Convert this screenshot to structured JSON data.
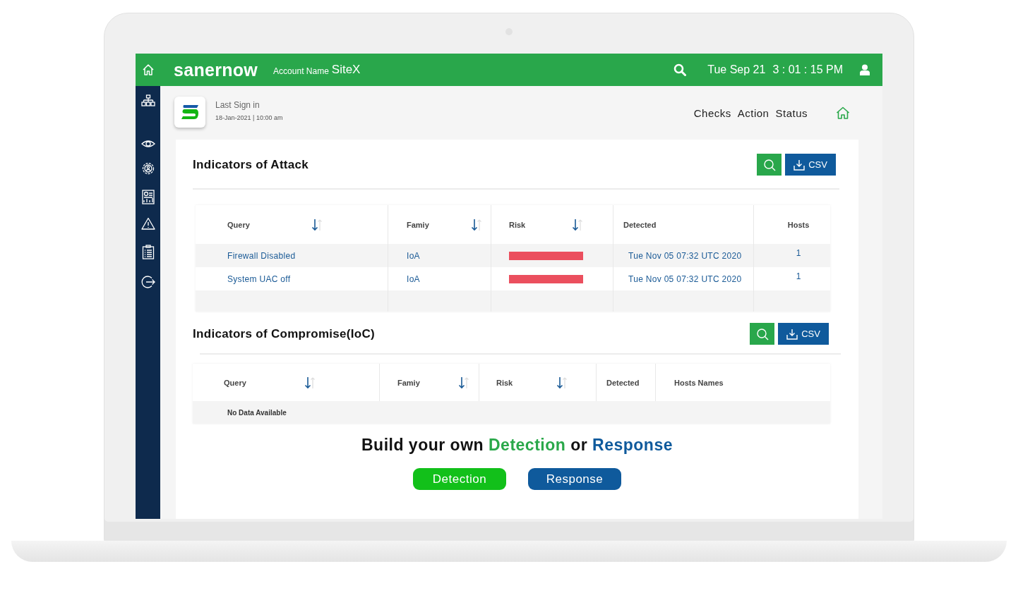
{
  "top_bar": {
    "brand": "sanernow",
    "account_label": "Account Name",
    "account_name": "SiteX",
    "date": "Tue Sep 21",
    "time": "3 : 01 : 15 PM"
  },
  "header": {
    "last_sign_in_label": "Last Sign in",
    "last_sign_in_value": "18-Jan-2021 | 10:00 am",
    "nav": [
      "Checks",
      "Action",
      "Status"
    ]
  },
  "sections": [
    {
      "title": "Indicators of Attack",
      "csv_button": "CSV",
      "table": {
        "columns": [
          {
            "label": "Query",
            "sortable": true
          },
          {
            "label": "Famiy",
            "sortable": true
          },
          {
            "label": "Risk",
            "sortable": true
          },
          {
            "label": "Detected",
            "sortable": false
          },
          {
            "label": "Hosts",
            "sortable": false
          }
        ],
        "rows": [
          {
            "cells": [
              {
                "kind": "link",
                "text": "Firewall Disabled"
              },
              {
                "kind": "link",
                "text": "IoA"
              },
              {
                "kind": "risk"
              },
              {
                "kind": "link",
                "text": "Tue Nov 05 07:32 UTC 2020"
              },
              {
                "kind": "count",
                "text": "1"
              }
            ]
          },
          {
            "cells": [
              {
                "kind": "link",
                "text": "System UAC off"
              },
              {
                "kind": "link",
                "text": "IoA"
              },
              {
                "kind": "risk"
              },
              {
                "kind": "link",
                "text": "Tue Nov 05 07:32 UTC 2020"
              },
              {
                "kind": "count",
                "text": "1"
              }
            ]
          }
        ]
      }
    },
    {
      "title": "Indicators of Compromise(IoC)",
      "csv_button": "CSV",
      "table": {
        "columns": [
          {
            "label": "Query",
            "sortable": true
          },
          {
            "label": "Famiy",
            "sortable": true
          },
          {
            "label": "Risk",
            "sortable": true
          },
          {
            "label": "Detected",
            "sortable": false
          },
          {
            "label": "Hosts Names",
            "sortable": false
          }
        ],
        "empty_message": "No Data Available"
      }
    }
  ],
  "cta": {
    "heading": [
      {
        "text": "Build your own",
        "color": "#111111"
      },
      {
        "text": "Detection",
        "color": "#2aa84a"
      },
      {
        "text": "or",
        "color": "#111111"
      },
      {
        "text": "Response",
        "color": "#0f5a9c"
      }
    ],
    "buttons": [
      {
        "label": "Detection",
        "kind": "detection"
      },
      {
        "label": "Response",
        "kind": "response"
      }
    ]
  }
}
